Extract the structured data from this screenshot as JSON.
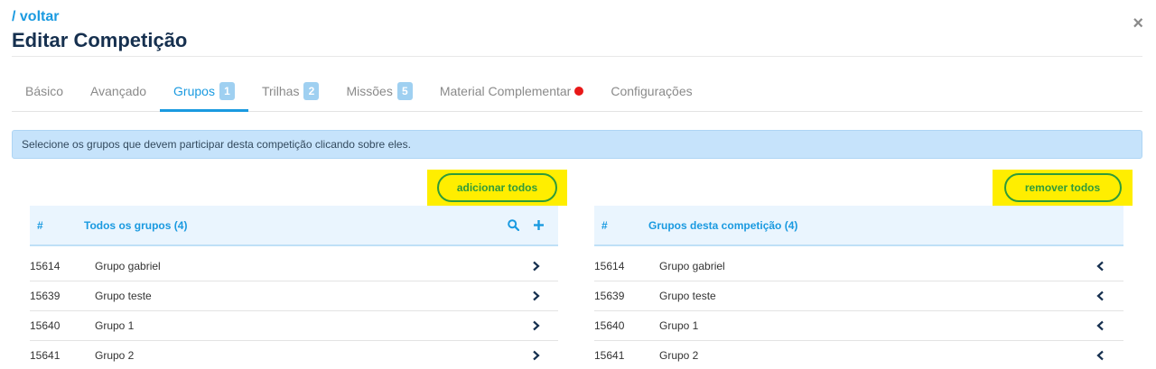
{
  "header": {
    "back_label": "/ voltar",
    "title": "Editar Competição",
    "close_label": "×"
  },
  "tabs": [
    {
      "label": "Básico",
      "badge": null,
      "active": false
    },
    {
      "label": "Avançado",
      "badge": null,
      "active": false
    },
    {
      "label": "Grupos",
      "badge": "1",
      "active": true
    },
    {
      "label": "Trilhas",
      "badge": "2",
      "active": false
    },
    {
      "label": "Missões",
      "badge": "5",
      "active": false
    },
    {
      "label": "Material Complementar",
      "badge": null,
      "active": false,
      "alert_dot": true
    },
    {
      "label": "Configurações",
      "badge": null,
      "active": false
    }
  ],
  "info_message": "Selecione os grupos que devem participar desta competição clicando sobre eles.",
  "left_panel": {
    "action_label": "adicionar todos",
    "hash_label": "#",
    "title": "Todos os grupos (4)",
    "icons": [
      "search-icon",
      "plus-icon"
    ],
    "rows": [
      {
        "id": "15614",
        "name": "Grupo gabriel"
      },
      {
        "id": "15639",
        "name": "Grupo teste"
      },
      {
        "id": "15640",
        "name": "Grupo 1"
      },
      {
        "id": "15641",
        "name": "Grupo 2"
      }
    ]
  },
  "right_panel": {
    "action_label": "remover todos",
    "hash_label": "#",
    "title": "Grupos desta competição (4)",
    "rows": [
      {
        "id": "15614",
        "name": "Grupo gabriel"
      },
      {
        "id": "15639",
        "name": "Grupo teste"
      },
      {
        "id": "15640",
        "name": "Grupo 1"
      },
      {
        "id": "15641",
        "name": "Grupo 2"
      }
    ]
  },
  "colors": {
    "accent": "#1a9ae0",
    "title": "#16304f",
    "highlight": "#ffee00",
    "button_green": "#2f9b3a",
    "alert_bg": "#c6e3fb",
    "dot_red": "#e81818",
    "row_icon": "#16304f"
  }
}
